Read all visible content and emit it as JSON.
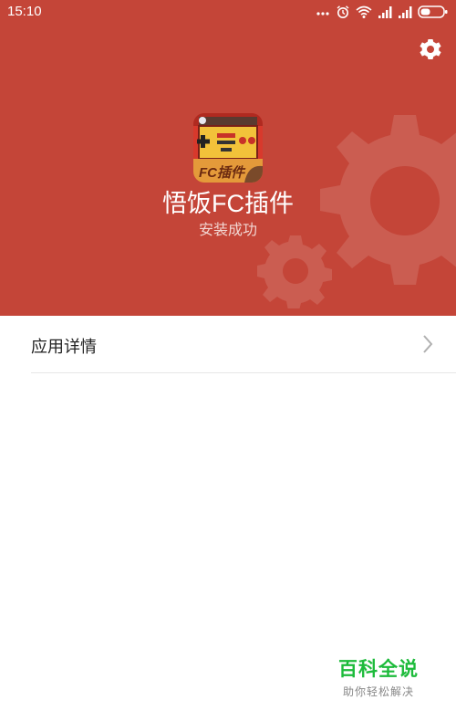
{
  "status_bar": {
    "time": "15:10",
    "icons": [
      "more-dots-icon",
      "alarm-icon",
      "wifi-icon",
      "signal-icon",
      "signal-icon",
      "battery-icon"
    ]
  },
  "header": {
    "background_color": "#c44538",
    "settings_icon": "gear-icon",
    "app_name": "悟饭FC插件",
    "install_status": "安装成功",
    "app_icon_label": "FC插件"
  },
  "list": {
    "items": [
      {
        "label": "应用详情",
        "icon": "chevron-right-icon"
      }
    ]
  },
  "watermark": {
    "title": "百科全说",
    "subtitle": "助你轻松解决",
    "color": "#1dbb3b"
  }
}
